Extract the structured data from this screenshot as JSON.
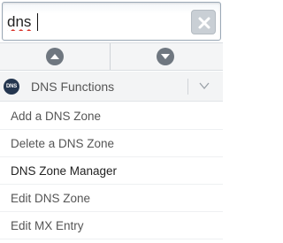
{
  "search": {
    "value": "dns",
    "clear_icon": "close-icon"
  },
  "nav": {
    "up_icon": "chevron-up-icon",
    "down_icon": "chevron-down-icon"
  },
  "group": {
    "badge": "DNS",
    "title": "DNS Functions",
    "expand_icon": "chevron-down-icon"
  },
  "items": [
    {
      "label": "Add a DNS Zone"
    },
    {
      "label": "Delete a DNS Zone"
    },
    {
      "label": "DNS Zone Manager"
    },
    {
      "label": "Edit DNS Zone"
    },
    {
      "label": "Edit MX Entry"
    }
  ],
  "colors": {
    "badge_bg": "#24364f",
    "nav_circle": "#6f7780",
    "spell_error": "#d9342b"
  }
}
